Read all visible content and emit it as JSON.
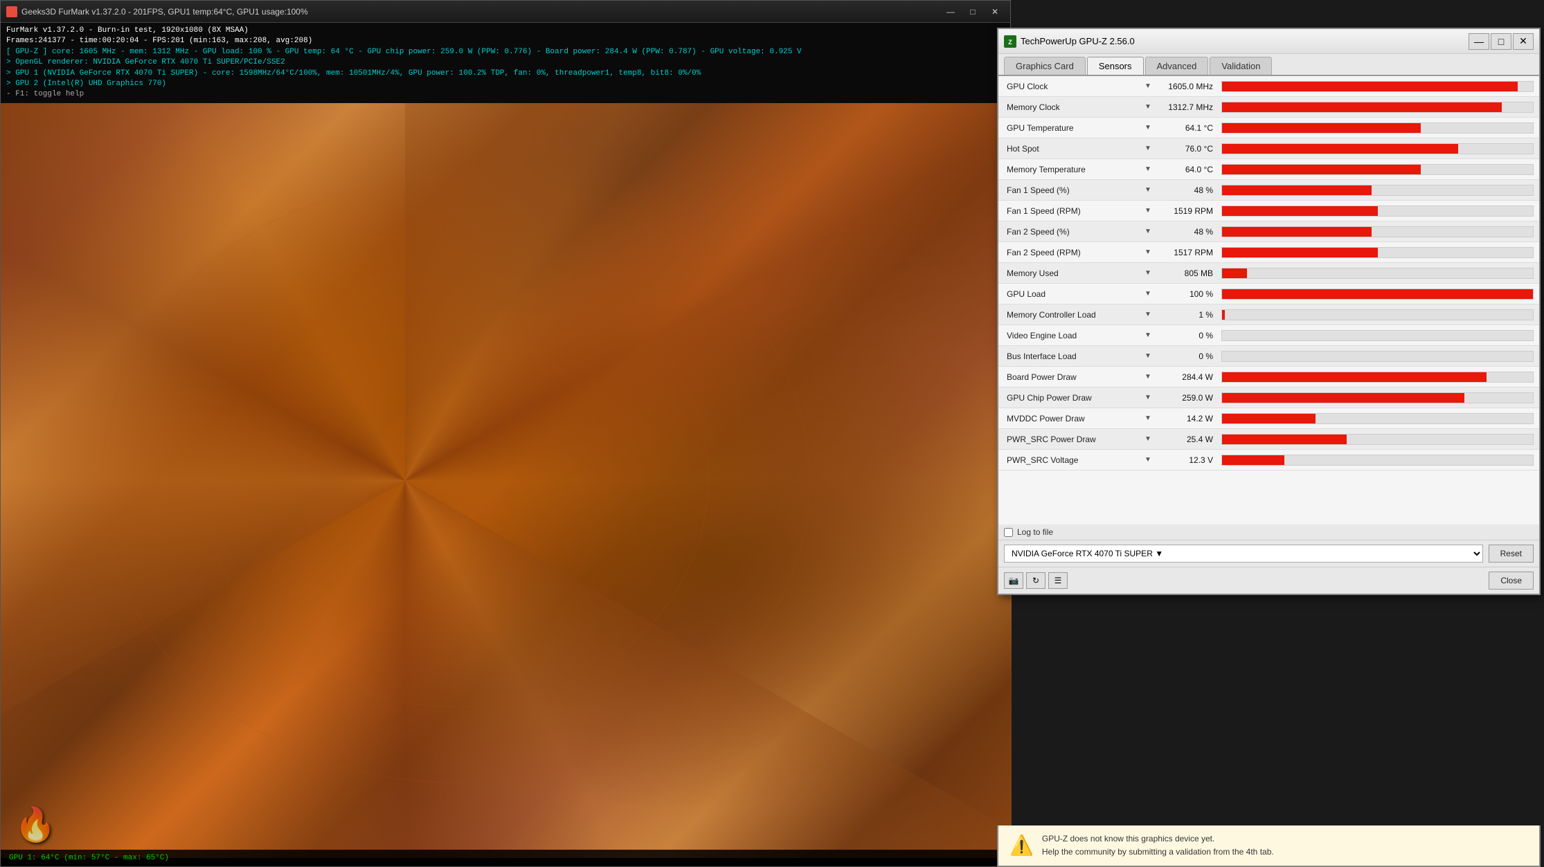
{
  "furmark": {
    "title": "Geeks3D FurMark v1.37.2.0 - 201FPS, GPU1 temp:64°C, GPU1 usage:100%",
    "info_lines": [
      "FurMark v1.37.2.0 - Burn-in test, 1920x1080 (8X MSAA)",
      "Frames:241377 - time:00:20:04 - FPS:201 (min:163, max:208, avg:208)",
      "[ GPU-Z ] core: 1605 MHz - mem: 1312 MHz - GPU load: 100 % - GPU temp: 64 °C - GPU chip power: 259.0 W (PPW: 0.776) - Board power: 284.4 W (PPW: 0.787) - GPU voltage: 0.925 V",
      "> OpenGL renderer: NVIDIA GeForce RTX 4070 Ti SUPER/PCIe/SSE2",
      "> GPU 1 (NVIDIA GeForce RTX 4070 Ti SUPER) - core: 1598MHz/64°C/100%, mem: 10501MHz/4%, GPU power: 100.2% TDP, fan: 0%, threadpower1, temp8, bit8: 0%/0%",
      "> GPU 2 (Intel(R) UHD Graphics 770)",
      "- F1: toggle help"
    ],
    "gpu_temp_bar": "GPU 1: 64°C (min: 57°C - max: 65°C)"
  },
  "gpuz": {
    "title": "TechPowerUp GPU-Z 2.56.0",
    "tabs": [
      "Graphics Card",
      "Sensors",
      "Advanced",
      "Validation"
    ],
    "active_tab": "Sensors",
    "sensors": [
      {
        "name": "GPU Clock",
        "value": "1605.0 MHz",
        "bar_pct": 95
      },
      {
        "name": "Memory Clock",
        "value": "1312.7 MHz",
        "bar_pct": 90
      },
      {
        "name": "GPU Temperature",
        "value": "64.1 °C",
        "bar_pct": 64
      },
      {
        "name": "Hot Spot",
        "value": "76.0 °C",
        "bar_pct": 76
      },
      {
        "name": "Memory Temperature",
        "value": "64.0 °C",
        "bar_pct": 64
      },
      {
        "name": "Fan 1 Speed (%)",
        "value": "48 %",
        "bar_pct": 48
      },
      {
        "name": "Fan 1 Speed (RPM)",
        "value": "1519 RPM",
        "bar_pct": 50
      },
      {
        "name": "Fan 2 Speed (%)",
        "value": "48 %",
        "bar_pct": 48
      },
      {
        "name": "Fan 2 Speed (RPM)",
        "value": "1517 RPM",
        "bar_pct": 50
      },
      {
        "name": "Memory Used",
        "value": "805 MB",
        "bar_pct": 8
      },
      {
        "name": "GPU Load",
        "value": "100 %",
        "bar_pct": 100
      },
      {
        "name": "Memory Controller Load",
        "value": "1 %",
        "bar_pct": 1
      },
      {
        "name": "Video Engine Load",
        "value": "0 %",
        "bar_pct": 0
      },
      {
        "name": "Bus Interface Load",
        "value": "0 %",
        "bar_pct": 0
      },
      {
        "name": "Board Power Draw",
        "value": "284.4 W",
        "bar_pct": 85
      },
      {
        "name": "GPU Chip Power Draw",
        "value": "259.0 W",
        "bar_pct": 78
      },
      {
        "name": "MVDDC Power Draw",
        "value": "14.2 W",
        "bar_pct": 30
      },
      {
        "name": "PWR_SRC Power Draw",
        "value": "25.4 W",
        "bar_pct": 40
      },
      {
        "name": "PWR_SRC Voltage",
        "value": "12.3 V",
        "bar_pct": 20
      }
    ],
    "device": "NVIDIA GeForce RTX 4070 Ti SUPER",
    "log_label": "Log to file",
    "reset_label": "Reset",
    "close_label": "Close",
    "warning": {
      "text1": "GPU-Z does not know this graphics device yet.",
      "text2": "Help the community by submitting a validation from the 4th tab."
    },
    "window_controls": {
      "minimize": "—",
      "maximize": "□",
      "close": "✕"
    }
  }
}
